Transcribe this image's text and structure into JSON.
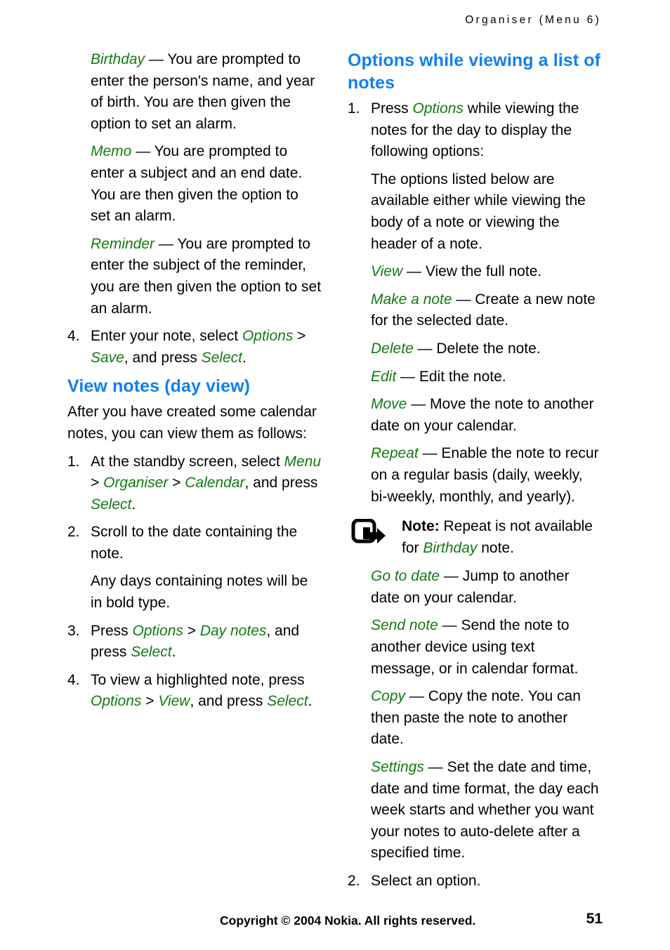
{
  "running_head": "Organiser (Menu 6)",
  "left_column": {
    "note_types": [
      {
        "term": "Birthday",
        "body": "— You are prompted to enter the person's name, and year of birth. You are then given the option to set an alarm."
      },
      {
        "term": "Memo",
        "body": "— You are prompted to enter a subject and an end date. You are then given the option to set an alarm."
      },
      {
        "term": "Reminder",
        "body": "— You are prompted to enter the subject of the reminder, you are then given the option to set an alarm."
      }
    ],
    "step4": {
      "num": "4.",
      "t1": "Enter your note, select ",
      "e1": "Options",
      "t2": " > ",
      "e2": "Save",
      "t3": ", and press ",
      "e3": "Select",
      "t4": "."
    },
    "heading": "View notes (day view)",
    "intro": "After you have created some calendar notes, you can view them as follows:",
    "steps": [
      {
        "num": "1.",
        "t1": "At the standby screen, select ",
        "e1": "Menu",
        "t2": " > ",
        "e2": "Organiser",
        "t3": " > ",
        "e3": "Calendar",
        "t4": ", and press ",
        "e4": "Select",
        "t5": "."
      },
      {
        "num": "2.",
        "t1": "Scroll to the date containing the note."
      },
      {
        "num": "3.",
        "t1": "Press ",
        "e1": "Options",
        "t2": " > ",
        "e2": "Day notes",
        "t3": ", and press ",
        "e3": "Select",
        "t4": "."
      },
      {
        "num": "4.",
        "t1": "To view a highlighted note, press ",
        "e1": "Options",
        "t2": " > ",
        "e2": "View",
        "t3": ", and press ",
        "e3": "Select",
        "t4": "."
      }
    ],
    "bold_type_note": "Any days containing notes will be in bold type."
  },
  "right_column": {
    "heading": "Options while viewing a list of notes",
    "step1": {
      "num": "1.",
      "t1": "Press ",
      "e1": "Options",
      "t2": " while viewing the notes for the day to display the following options:"
    },
    "availability_note": "The options listed below are available either while viewing the body of a note or viewing the header of a note.",
    "options": [
      {
        "term": "View",
        "body": "— View the full note."
      },
      {
        "term": "Make a note",
        "body": "— Create a new note for the selected date."
      },
      {
        "term": "Delete",
        "body": "— Delete the note."
      },
      {
        "term": "Edit",
        "body": "— Edit the note."
      },
      {
        "term": "Move",
        "body": "— Move the note to another date on your calendar."
      },
      {
        "term": "Repeat",
        "body": "— Enable the note to recur on a regular basis (daily, weekly, bi-weekly, monthly, and yearly)."
      }
    ],
    "callout": {
      "icon": "note-arrow-icon",
      "label": "Note:",
      "t1": " Repeat is not available for ",
      "e1": "Birthday",
      "t2": " note."
    },
    "options2": [
      {
        "term": "Go to date",
        "body": "— Jump to another date on your calendar."
      },
      {
        "term": "Send note",
        "body": "— Send the note to another device using text message, or in calendar format."
      },
      {
        "term": "Copy",
        "body": "— Copy the note. You can then paste the note to another date."
      },
      {
        "term": "Settings",
        "body": "— Set the date and time, date and time format, the day each week starts and whether you want your notes to auto-delete after a specified time."
      }
    ],
    "step2": {
      "num": "2.",
      "t1": "Select an option."
    }
  },
  "footer": {
    "copyright": "Copyright © 2004 Nokia. All rights reserved.",
    "page_number": "51"
  },
  "colors": {
    "heading_blue": "#1080f0",
    "term_green": "#127a12",
    "body_black": "#000000"
  }
}
